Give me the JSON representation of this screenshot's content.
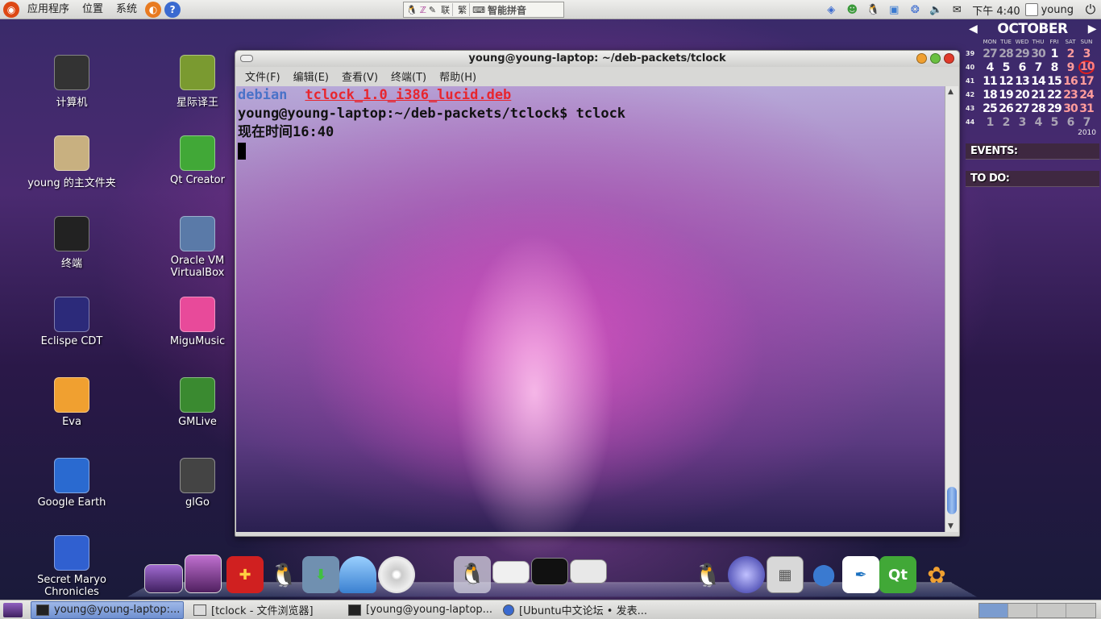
{
  "top_panel": {
    "menus": [
      "应用程序",
      "位置",
      "系统"
    ],
    "ime_label": "智能拼音",
    "ime_segments": [
      "联",
      "繁"
    ],
    "clock": "下午 4:40",
    "user": "young"
  },
  "desktop_icons": [
    {
      "label": "计算机",
      "icon": "computer-icon",
      "color": "#333333"
    },
    {
      "label": "星际译王",
      "icon": "stardict-icon",
      "color": "#7a9a30"
    },
    {
      "label": "young 的主文件夹",
      "icon": "home-folder-icon",
      "color": "#c8b080"
    },
    {
      "label": "Qt Creator",
      "icon": "qt-creator-icon",
      "color": "#41a837"
    },
    {
      "label": "终端",
      "icon": "terminal-icon",
      "color": "#222222"
    },
    {
      "label": "Oracle VM VirtualBox",
      "icon": "virtualbox-icon",
      "color": "#5a7aa8"
    },
    {
      "label": "Eclispe CDT",
      "icon": "eclipse-icon",
      "color": "#2c2a7a"
    },
    {
      "label": "MiguMusic",
      "icon": "migumusic-icon",
      "color": "#e84a9a"
    },
    {
      "label": "Eva",
      "icon": "eva-icon",
      "color": "#f0a030"
    },
    {
      "label": "GMLive",
      "icon": "gmlive-icon",
      "color": "#3a8a30"
    },
    {
      "label": "Google Earth",
      "icon": "google-earth-icon",
      "color": "#2a6ad0"
    },
    {
      "label": "glGo",
      "icon": "glgo-icon",
      "color": "#444444"
    },
    {
      "label": "Secret Maryo Chronicles",
      "icon": "maryo-icon",
      "color": "#3060d0"
    }
  ],
  "terminal": {
    "title": "young@young-laptop: ~/deb-packets/tclock",
    "menu": [
      "文件(F)",
      "编辑(E)",
      "查看(V)",
      "终端(T)",
      "帮助(H)"
    ],
    "ls_dir": "debian",
    "ls_file": "tclock_1.0_i386_lucid.deb",
    "prompt_line": "young@young-laptop:~/deb-packets/tclock$ tclock",
    "output_line": "现在时间16:40"
  },
  "calendar": {
    "month": "OCTOBER",
    "year": "2010",
    "dow": [
      "MON",
      "TUE",
      "WED",
      "THU",
      "FRI",
      "SAT",
      "SUN"
    ],
    "weeks": [
      {
        "wk": "39",
        "days": [
          "27",
          "28",
          "29",
          "30",
          "1",
          "2",
          "3"
        ]
      },
      {
        "wk": "40",
        "days": [
          "4",
          "5",
          "6",
          "7",
          "8",
          "9",
          "10"
        ]
      },
      {
        "wk": "41",
        "days": [
          "11",
          "12",
          "13",
          "14",
          "15",
          "16",
          "17"
        ]
      },
      {
        "wk": "42",
        "days": [
          "18",
          "19",
          "20",
          "21",
          "22",
          "23",
          "24"
        ]
      },
      {
        "wk": "43",
        "days": [
          "25",
          "26",
          "27",
          "28",
          "29",
          "30",
          "31"
        ]
      },
      {
        "wk": "44",
        "days": [
          "1",
          "2",
          "3",
          "4",
          "5",
          "6",
          "7"
        ]
      }
    ],
    "today": "10",
    "events_label": "EVENTS:",
    "todo_label": "TO DO:"
  },
  "taskbar": {
    "tasks": [
      {
        "label": "young@young-laptop:...",
        "active": true
      },
      {
        "label": "[tclock - 文件浏览器]",
        "active": false
      },
      {
        "label": "[young@young-laptop...",
        "active": false
      },
      {
        "label": "[Ubuntu中文论坛 • 发表...",
        "active": false
      }
    ]
  }
}
